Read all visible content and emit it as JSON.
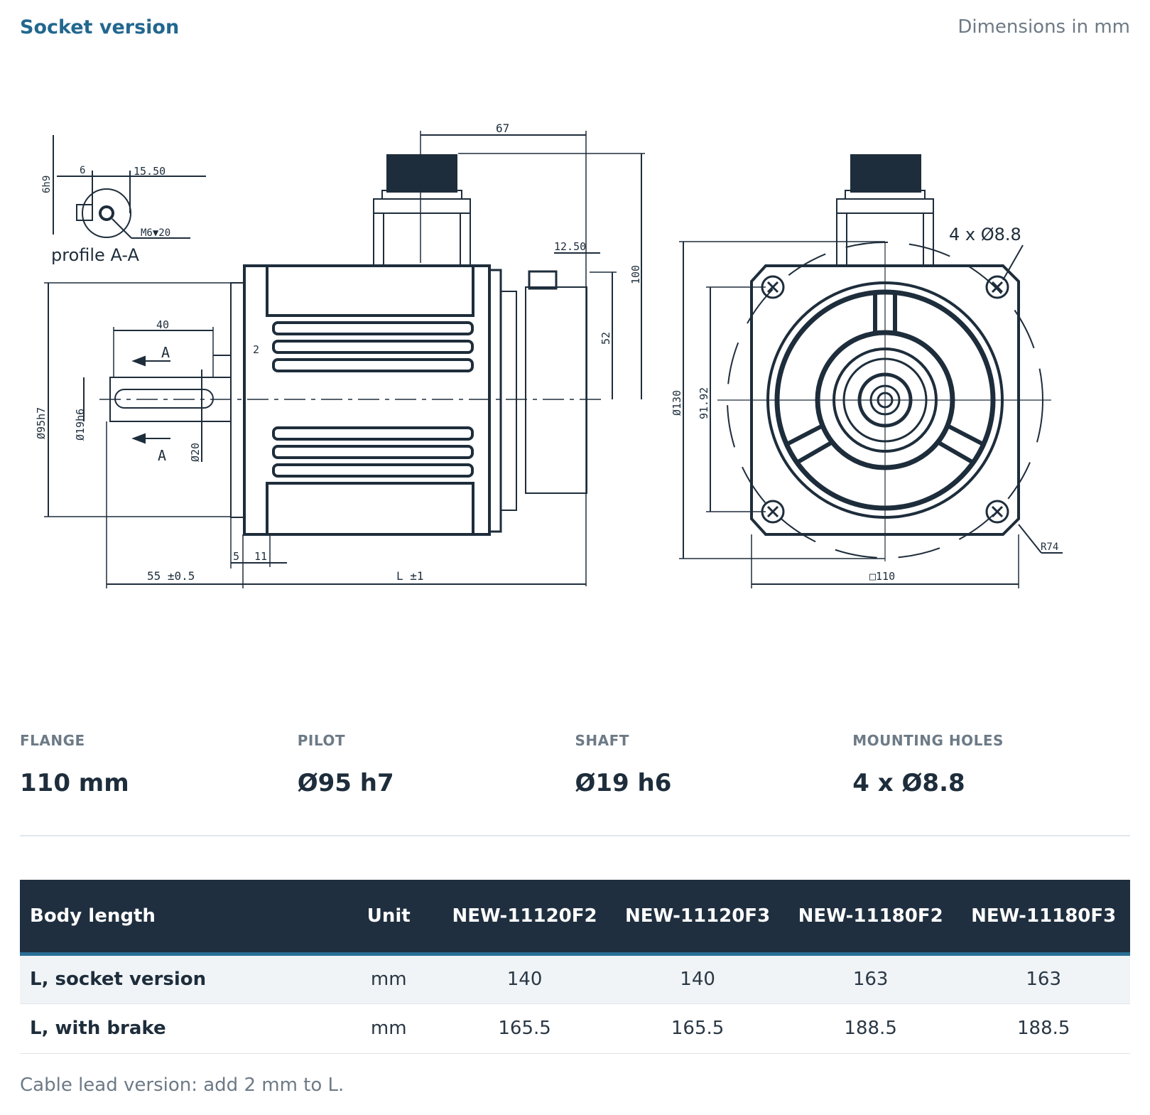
{
  "header": {
    "title": "Socket version",
    "units_note": "Dimensions in mm"
  },
  "drawing": {
    "profile_label": "profile A-A",
    "section_marker": "A",
    "dims": {
      "d67": "67",
      "d100": "100",
      "d52": "52",
      "d12_50": "12.50",
      "d40": "40",
      "d2": "2",
      "d95": "Ø95h7",
      "d19": "Ø19h6",
      "d20": "Ø20",
      "d5": "5",
      "d11": "11",
      "d55": "55 ±0.5",
      "dL": "L ±1",
      "d6": "6",
      "d15_50": "15.50",
      "d6h9": "6h9",
      "dM6": "M6▼20",
      "d130": "Ø130",
      "d91_92": "91.92",
      "d110": "□110",
      "dR74": "R74",
      "holes": "4 x Ø8.8"
    }
  },
  "specs": [
    {
      "label": "FLANGE",
      "value": "110 mm"
    },
    {
      "label": "PILOT",
      "value": "Ø95 h7"
    },
    {
      "label": "SHAFT",
      "value": "Ø19 h6"
    },
    {
      "label": "MOUNTING HOLES",
      "value": "4 x Ø8.8"
    }
  ],
  "table": {
    "headers": {
      "body_length": "Body length",
      "unit": "Unit",
      "m1": "NEW-11120F2",
      "m2": "NEW-11120F3",
      "m3": "NEW-11180F2",
      "m4": "NEW-11180F3"
    },
    "rows": [
      {
        "label": "L, socket version",
        "unit": "mm",
        "values": [
          "140",
          "140",
          "163",
          "163"
        ]
      },
      {
        "label": "L, with brake",
        "unit": "mm",
        "values": [
          "165.5",
          "165.5",
          "188.5",
          "188.5"
        ]
      }
    ]
  },
  "note": "Cable lead version: add 2 mm to L."
}
